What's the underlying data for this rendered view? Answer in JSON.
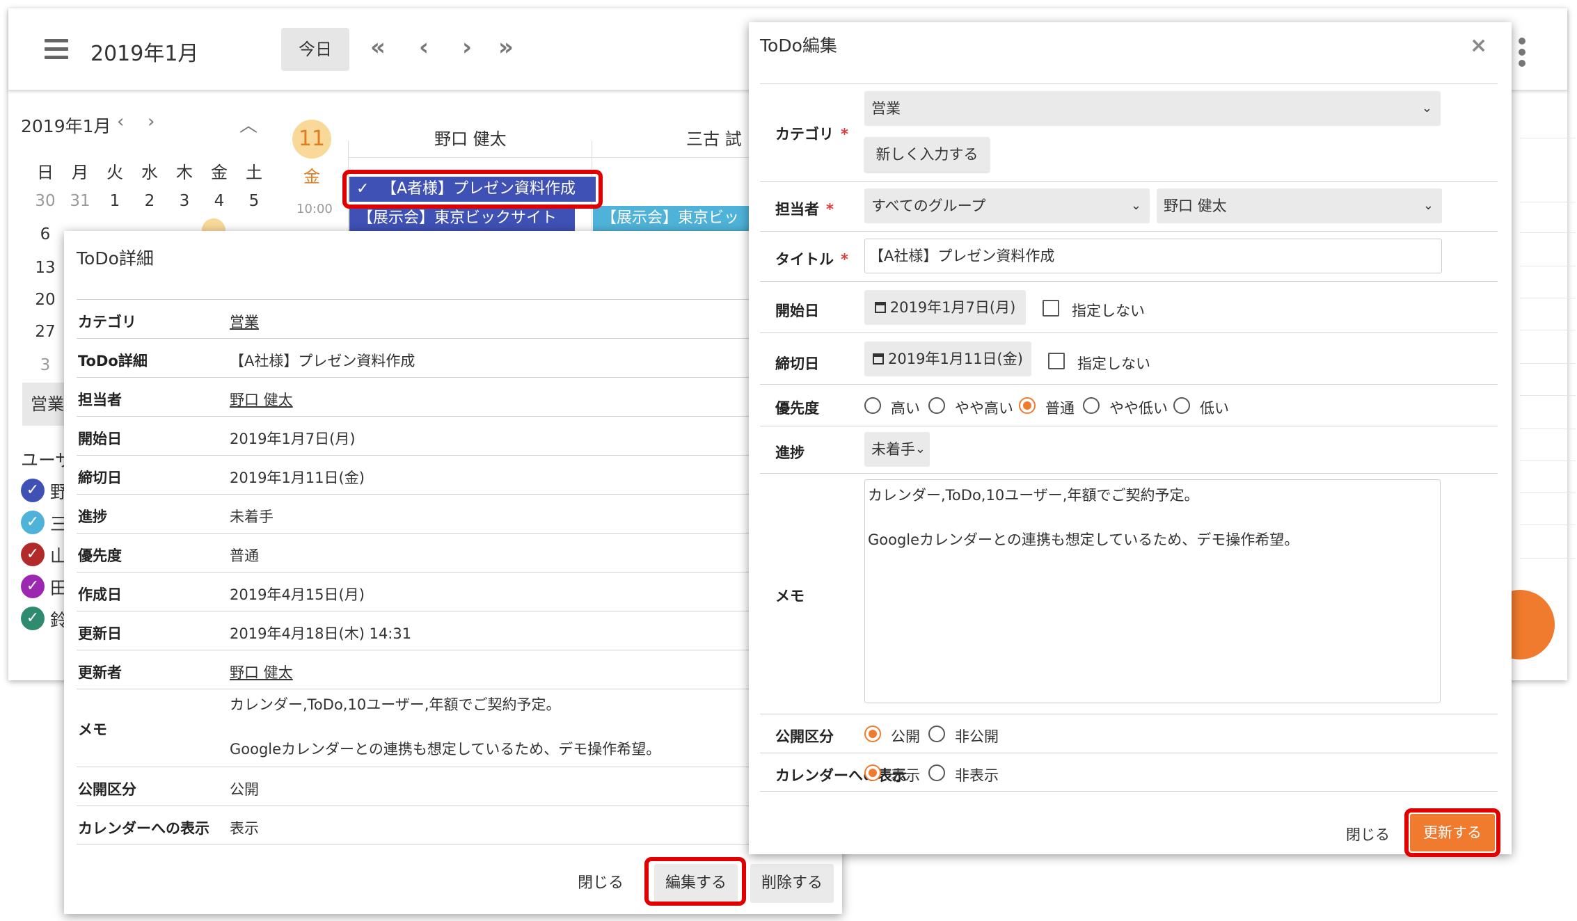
{
  "calendar": {
    "title": "2019年1月",
    "today_label": "今日",
    "nav": {
      "prev_month": "«",
      "prev": "‹",
      "next": "›",
      "next_month": "»"
    },
    "mini": {
      "title": "2019年1月",
      "prev": "‹",
      "next": "›",
      "collapse": "︿",
      "weekdays": [
        "日",
        "月",
        "火",
        "水",
        "木",
        "金",
        "土"
      ],
      "rows": [
        [
          "30",
          "31",
          "1",
          "2",
          "3",
          "4",
          "5"
        ],
        [
          "6"
        ],
        [
          "13"
        ],
        [
          "20"
        ],
        [
          "27"
        ],
        [
          "3"
        ]
      ]
    },
    "category_chip": "営業",
    "users_label": "ユーザ",
    "users": [
      {
        "name": "野",
        "color": "#3f51b5"
      },
      {
        "name": "三",
        "color": "#4fb3d9"
      },
      {
        "name": "山",
        "color": "#b22a2a"
      },
      {
        "name": "田",
        "color": "#9c27b0"
      },
      {
        "name": "鈴",
        "color": "#2e8b6e"
      }
    ],
    "day": {
      "number": "11",
      "weekday": "金",
      "time": "10:00"
    },
    "columns": [
      "野口 健太",
      "三古 試"
    ],
    "events": {
      "todo": "【A者様】プレゼン資料作成",
      "expo1": "【展示会】東京ビックサイト",
      "expo2": "【展示会】東京ビッ"
    }
  },
  "detail": {
    "title": "ToDo詳細",
    "rows": [
      {
        "label": "カテゴリ",
        "value": "営業"
      },
      {
        "label": "ToDo詳細",
        "value": "【A社様】プレゼン資料作成"
      },
      {
        "label": "担当者",
        "value": "野口 健太"
      },
      {
        "label": "開始日",
        "value": "2019年1月7日(月)"
      },
      {
        "label": "締切日",
        "value": "2019年1月11日(金)"
      },
      {
        "label": "進捗",
        "value": "未着手"
      },
      {
        "label": "優先度",
        "value": "普通"
      },
      {
        "label": "作成日",
        "value": "2019年4月15日(月)"
      },
      {
        "label": "更新日",
        "value": "2019年4月18日(木) 14:31"
      },
      {
        "label": "更新者",
        "value": "野口 健太"
      },
      {
        "label": "メモ",
        "value": "カレンダー,ToDo,10ユーザー,年額でご契約予定。\n\nGoogleカレンダーとの連携も想定しているため、デモ操作希望。"
      },
      {
        "label": "公開区分",
        "value": "公開"
      },
      {
        "label": "カレンダーへの表示",
        "value": "表示"
      }
    ],
    "buttons": {
      "close": "閉じる",
      "edit": "編集する",
      "delete": "削除する"
    }
  },
  "edit": {
    "title": "ToDo編集",
    "close_icon": "×",
    "category": {
      "label": "カテゴリ",
      "value": "営業",
      "new_button": "新しく入力する"
    },
    "assignee": {
      "label": "担当者",
      "group": "すべてのグループ",
      "user": "野口 健太"
    },
    "title_field": {
      "label": "タイトル",
      "value": "【A社様】プレゼン資料作成"
    },
    "start": {
      "label": "開始日",
      "value": "2019年1月7日(月)",
      "unset": "指定しない"
    },
    "due": {
      "label": "締切日",
      "value": "2019年1月11日(金)",
      "unset": "指定しない"
    },
    "priority": {
      "label": "優先度",
      "options": [
        "高い",
        "やや高い",
        "普通",
        "やや低い",
        "低い"
      ],
      "selected": "普通"
    },
    "progress": {
      "label": "進捗",
      "value": "未着手"
    },
    "memo": {
      "label": "メモ",
      "value": "カレンダー,ToDo,10ユーザー,年額でご契約予定。\n\nGoogleカレンダーとの連携も想定しているため、デモ操作希望。"
    },
    "visibility": {
      "label": "公開区分",
      "options": [
        "公開",
        "非公開"
      ],
      "selected": "公開"
    },
    "calendar_display": {
      "label": "カレンダーへの表示",
      "options": [
        "表示",
        "非表示"
      ],
      "selected": "表示"
    },
    "buttons": {
      "close": "閉じる",
      "update": "更新する"
    }
  },
  "colors": {
    "accent": "#f07a2d",
    "highlight": "#e00000",
    "event_blue": "#3f51b5",
    "event_cyan": "#4fb3d9"
  }
}
